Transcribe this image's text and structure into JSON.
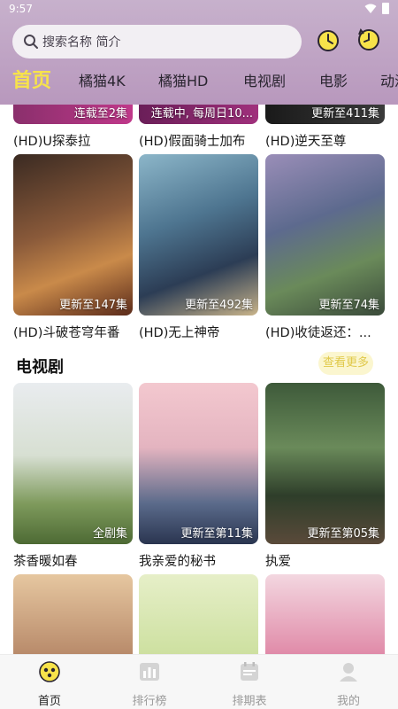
{
  "status": {
    "time": "9:57"
  },
  "search": {
    "placeholder": "搜索名称 简介"
  },
  "tabs": [
    {
      "label": "首页",
      "active": true
    },
    {
      "label": "橘猫4K"
    },
    {
      "label": "橘猫HD"
    },
    {
      "label": "电视剧"
    },
    {
      "label": "电影"
    },
    {
      "label": "动漫"
    }
  ],
  "top_row": [
    {
      "badge": "连载至2集",
      "title": "(HD)U探泰拉"
    },
    {
      "badge": "连载中, 每周日10...",
      "title": "(HD)假面骑士加布"
    },
    {
      "badge": "更新至411集",
      "title": "(HD)逆天至尊"
    }
  ],
  "anime_row": [
    {
      "badge": "更新至147集",
      "title": "(HD)斗破苍穹年番"
    },
    {
      "badge": "更新至492集",
      "title": "(HD)无上神帝"
    },
    {
      "badge": "更新至74集",
      "title": "(HD)收徒返还：..."
    }
  ],
  "section": {
    "title": "电视剧",
    "more": "查看更多"
  },
  "drama_row": [
    {
      "badge": "全剧集",
      "title": "茶香暖如春"
    },
    {
      "badge": "更新至第11集",
      "title": "我亲爱的秘书"
    },
    {
      "badge": "更新至第05集",
      "title": "执爱"
    }
  ],
  "bottom_nav": [
    {
      "label": "首页",
      "icon": "home-icon",
      "active": true
    },
    {
      "label": "排行榜",
      "icon": "chart-icon"
    },
    {
      "label": "排期表",
      "icon": "calendar-icon"
    },
    {
      "label": "我的",
      "icon": "user-icon"
    }
  ],
  "colors": {
    "accent": "#f7e34a",
    "header": "#c3a8c8"
  }
}
